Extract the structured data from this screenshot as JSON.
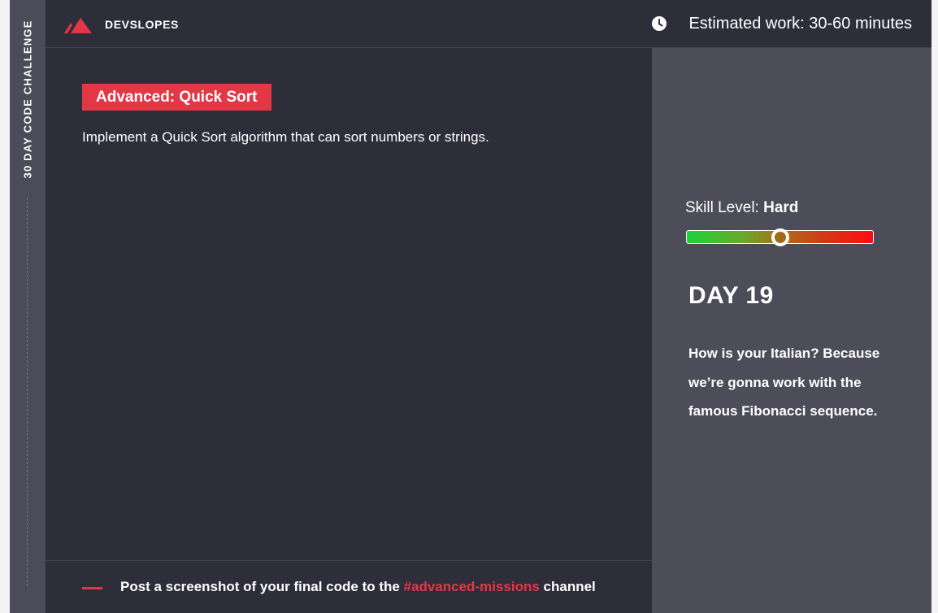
{
  "rail": {
    "title": "30 DAY CODE CHALLENGE"
  },
  "header": {
    "brand": "DEVSLOPES",
    "logo_icon": "mountain-logo-icon",
    "clock_icon": "clock-icon",
    "estimate": "Estimated work: 30-60 minutes"
  },
  "main": {
    "badge": "Advanced: Quick Sort",
    "description": "Implement a Quick Sort algorithm that can sort numbers or strings."
  },
  "footer": {
    "text_before": "Post a screenshot of your final code to the ",
    "channel": "#advanced-missions",
    "text_after": " channel"
  },
  "panel": {
    "skill_label": "Skill Level: ",
    "skill_value": "Hard",
    "skill_level_fraction": 0.5,
    "day": "DAY 19",
    "tagline": "How is your Italian? Because we’re gonna work with the famous Fibonacci sequence."
  },
  "colors": {
    "accent": "#e23846",
    "background": "#2e2d3a",
    "panel": "#4d4c59",
    "rail": "#4c4b59"
  }
}
